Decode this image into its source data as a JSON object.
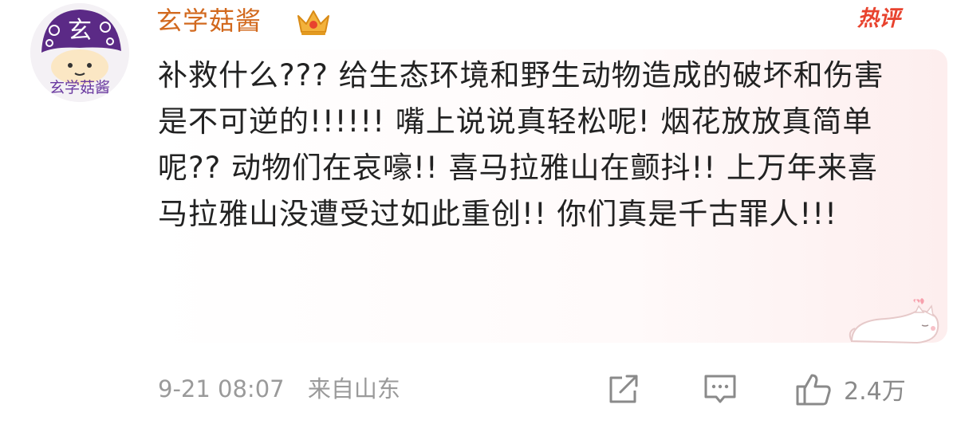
{
  "colors": {
    "username": "#d2691e",
    "hot_badge": "#e8432e",
    "comment_text": "#222222",
    "meta_text": "#9a9a9a",
    "icon": "#8a8a8a",
    "avatar_purple": "#5b2a86"
  },
  "comment": {
    "avatar_icon": "mushroom-avatar-icon",
    "avatar_caption": "玄学菇酱",
    "avatar_hat_char": "玄",
    "username": "玄学菇酱",
    "badge_icon": "crown-icon",
    "hot_label": "热评",
    "text": "补救什么??? 给生态环境和野生动物造成的破坏和伤害是不可逆的!!!!!! 嘴上说说真轻松呢! 烟花放放真简单呢?? 动物们在哀嚎!! 喜马拉雅山在颤抖!! 上万年来喜马拉雅山没遭受过如此重创!! 你们真是千古罪人!!!",
    "timestamp": "9-21 08:07",
    "location": "来自山东"
  },
  "actions": {
    "repost_icon": "repost-icon",
    "reply_icon": "comment-icon",
    "like_icon": "thumbs-up-icon",
    "like_count": "2.4万"
  }
}
